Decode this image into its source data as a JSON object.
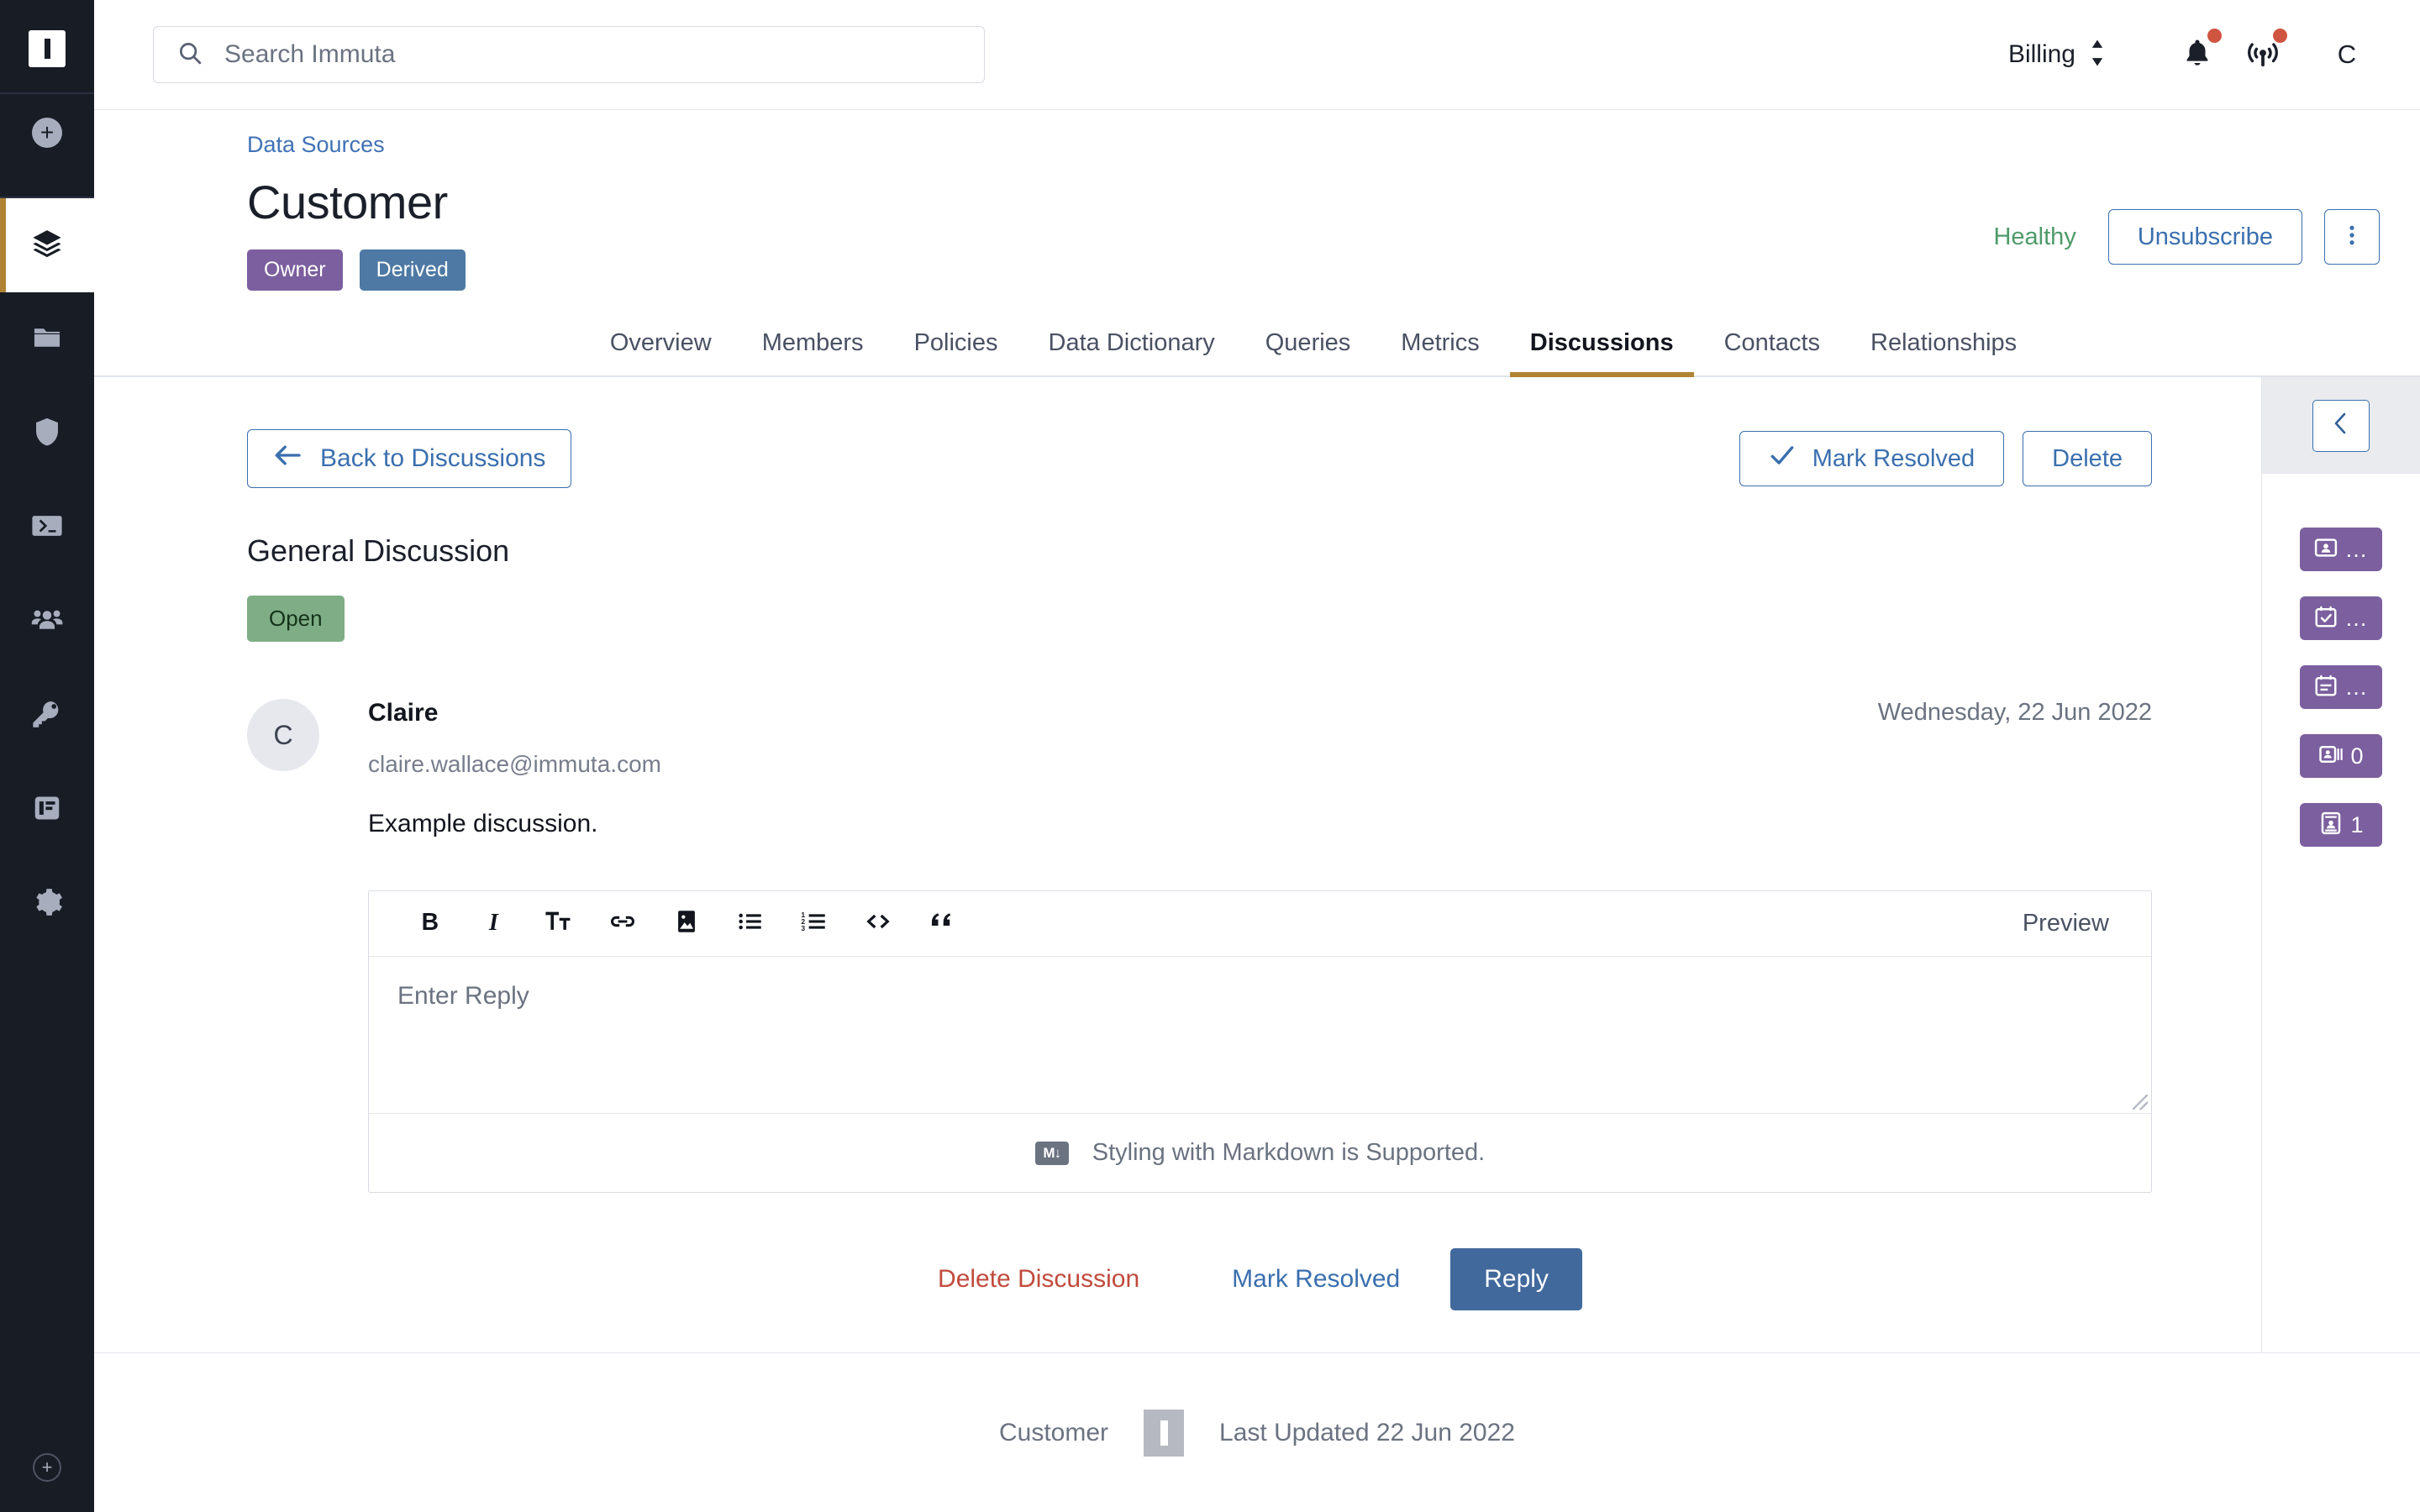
{
  "rail": {
    "logo_icon": "immuta-logo-icon",
    "add_label": "+",
    "items": [
      {
        "name": "data-sources",
        "icon": "layers-icon",
        "active": true
      },
      {
        "name": "projects",
        "icon": "folder-icon",
        "active": false
      },
      {
        "name": "policies",
        "icon": "shield-icon",
        "active": false
      },
      {
        "name": "query-engine",
        "icon": "terminal-icon",
        "active": false
      },
      {
        "name": "people",
        "icon": "users-icon",
        "active": false
      },
      {
        "name": "identity",
        "icon": "key-icon",
        "active": false
      },
      {
        "name": "audit",
        "icon": "report-icon",
        "active": false
      },
      {
        "name": "settings",
        "icon": "gear-icon",
        "active": false
      }
    ],
    "bottom_icon": "help-icon",
    "bottom_label": "+"
  },
  "topbar": {
    "search_placeholder": "Search Immuta",
    "search_value": "",
    "search_icon": "search-icon",
    "billing_label": "Billing",
    "billing_icon": "chevron-up-down-icon",
    "notifications_icon": "bell-icon",
    "notifications_has_badge": true,
    "broadcast_icon": "beacon-icon",
    "broadcast_has_badge": true,
    "avatar_initial": "C"
  },
  "page": {
    "breadcrumb": "Data Sources",
    "title": "Customer",
    "tags": [
      {
        "label": "Owner",
        "color": "#7b5f9e"
      },
      {
        "label": "Derived",
        "color": "#4d79a4"
      }
    ],
    "health_status": "Healthy",
    "health_color": "#4e9a6a",
    "unsubscribe_label": "Unsubscribe",
    "kebab_icon": "more-vertical-icon"
  },
  "tabs": [
    {
      "label": "Overview",
      "active": false
    },
    {
      "label": "Members",
      "active": false
    },
    {
      "label": "Policies",
      "active": false
    },
    {
      "label": "Data Dictionary",
      "active": false
    },
    {
      "label": "Queries",
      "active": false
    },
    {
      "label": "Metrics",
      "active": false
    },
    {
      "label": "Discussions",
      "active": true
    },
    {
      "label": "Contacts",
      "active": false
    },
    {
      "label": "Relationships",
      "active": false
    }
  ],
  "discussion": {
    "back_label": "Back to Discussions",
    "back_icon": "arrow-left-icon",
    "mark_resolved_label": "Mark Resolved",
    "mark_resolved_icon": "check-icon",
    "delete_label": "Delete",
    "title": "General Discussion",
    "status_badge": "Open",
    "status_color": "#7fae86",
    "comment": {
      "avatar_initial": "C",
      "author": "Claire",
      "email": "claire.wallace@immuta.com",
      "date": "Wednesday, 22 Jun 2022",
      "text": "Example discussion."
    },
    "editor": {
      "tools": [
        {
          "name": "bold",
          "icon": "bold-icon",
          "glyph": "B"
        },
        {
          "name": "italic",
          "icon": "italic-icon",
          "glyph": "I"
        },
        {
          "name": "text-size",
          "icon": "text-size-icon",
          "glyph": "Tt"
        },
        {
          "name": "link",
          "icon": "link-icon",
          "glyph": "link"
        },
        {
          "name": "image",
          "icon": "image-icon",
          "glyph": "image"
        },
        {
          "name": "bullet-list",
          "icon": "bullet-list-icon",
          "glyph": "ul"
        },
        {
          "name": "numbered-list",
          "icon": "numbered-list-icon",
          "glyph": "ol"
        },
        {
          "name": "code",
          "icon": "code-icon",
          "glyph": "<>"
        },
        {
          "name": "quote",
          "icon": "quote-icon",
          "glyph": "”"
        }
      ],
      "preview_label": "Preview",
      "placeholder": "Enter Reply",
      "value": "",
      "markdown_icon": "markdown-icon",
      "markdown_note": "Styling with Markdown is Supported."
    },
    "actions": {
      "delete_discussion_label": "Delete Discussion",
      "delete_discussion_color": "#c14a3c",
      "mark_resolved_label": "Mark Resolved",
      "reply_label": "Reply",
      "reply_color": "#42699c"
    }
  },
  "right_panel": {
    "collapse_icon": "chevron-left-icon",
    "badge_color": "#7b5f9e",
    "badges": [
      {
        "name": "contacts-badge",
        "icon": "contact-card-icon",
        "value": "…"
      },
      {
        "name": "tasks-badge",
        "icon": "calendar-check-icon",
        "value": "…"
      },
      {
        "name": "notes-badge",
        "icon": "calendar-list-icon",
        "value": "…"
      },
      {
        "name": "subscribers-badge",
        "icon": "id-list-icon",
        "value": "0"
      },
      {
        "name": "owners-badge",
        "icon": "id-card-icon",
        "value": "1"
      }
    ]
  },
  "footer": {
    "name": "Customer",
    "logo_icon": "immuta-logo-icon",
    "last_updated": "Last Updated 22 Jun 2022"
  }
}
